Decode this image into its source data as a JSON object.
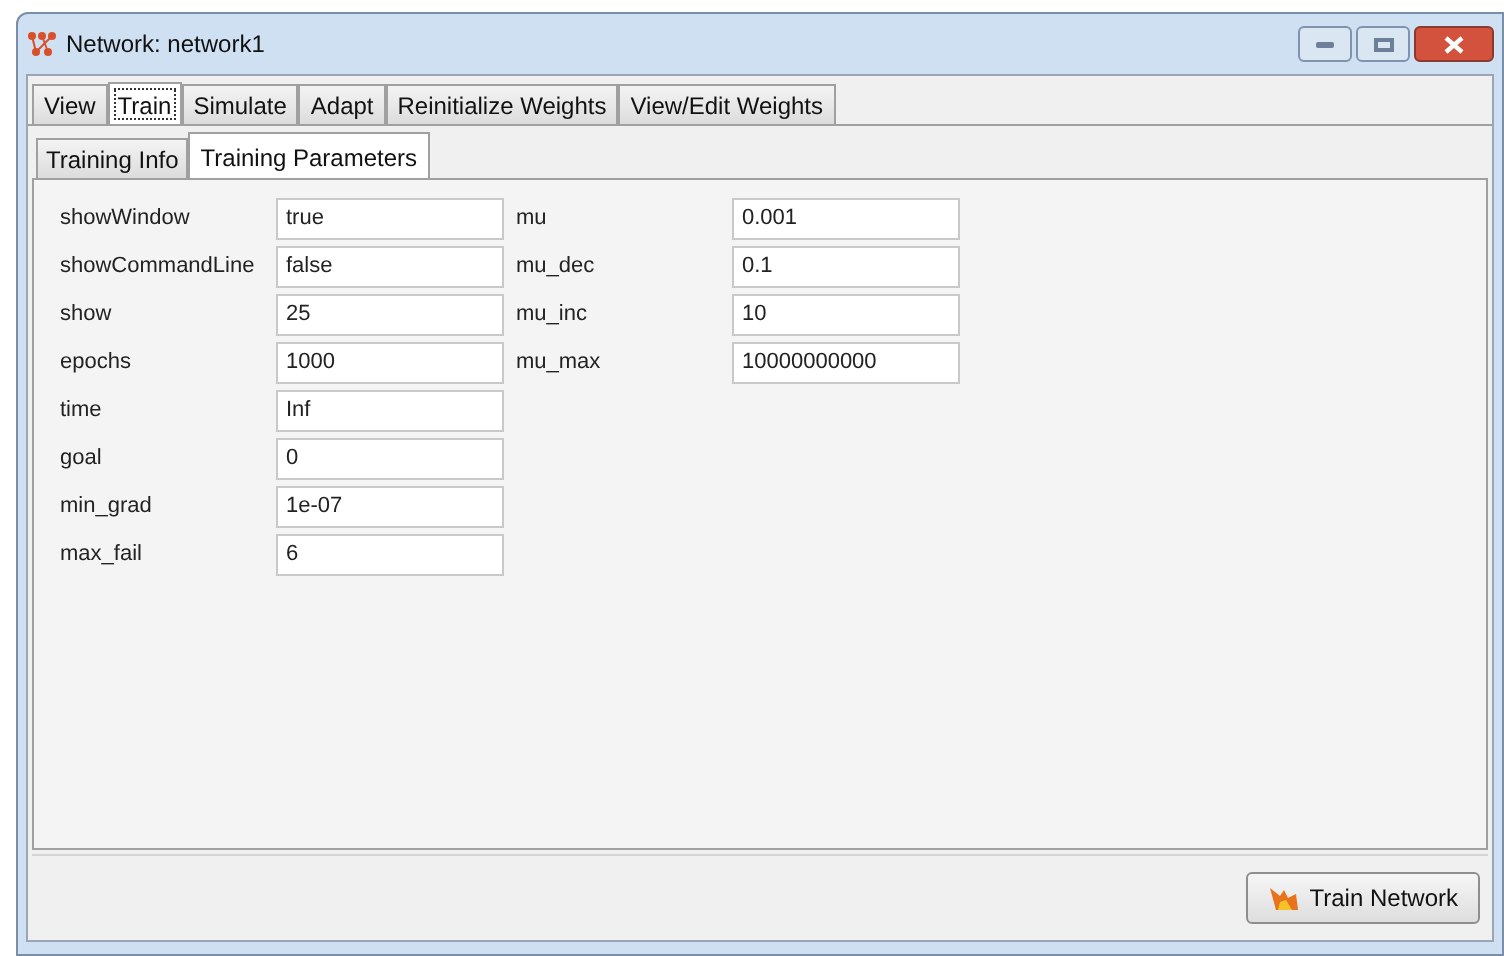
{
  "window": {
    "title": "Network: network1"
  },
  "tabs": [
    {
      "label": "View",
      "selected": false
    },
    {
      "label": "Train",
      "selected": true
    },
    {
      "label": "Simulate",
      "selected": false
    },
    {
      "label": "Adapt",
      "selected": false
    },
    {
      "label": "Reinitialize Weights",
      "selected": false
    },
    {
      "label": "View/Edit Weights",
      "selected": false
    }
  ],
  "subtabs": [
    {
      "label": "Training Info",
      "selected": false
    },
    {
      "label": "Training Parameters",
      "selected": true
    }
  ],
  "parameters_left": [
    {
      "label": "showWindow",
      "value": "true"
    },
    {
      "label": "showCommandLine",
      "value": "false"
    },
    {
      "label": "show",
      "value": "25"
    },
    {
      "label": "epochs",
      "value": "1000"
    },
    {
      "label": "time",
      "value": "Inf"
    },
    {
      "label": "goal",
      "value": "0"
    },
    {
      "label": "min_grad",
      "value": "1e-07"
    },
    {
      "label": "max_fail",
      "value": "6"
    }
  ],
  "parameters_right": [
    {
      "label": "mu",
      "value": "0.001"
    },
    {
      "label": "mu_dec",
      "value": "0.1"
    },
    {
      "label": "mu_inc",
      "value": "10"
    },
    {
      "label": "mu_max",
      "value": "10000000000"
    }
  ],
  "train_button": {
    "label": "Train Network"
  }
}
